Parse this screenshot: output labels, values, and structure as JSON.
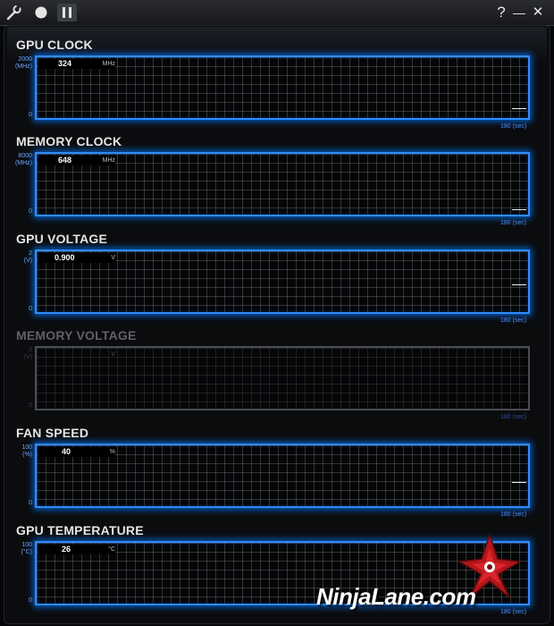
{
  "toolbar": {
    "help_label": "?",
    "minimize_label": "—",
    "close_label": "✕"
  },
  "panels": [
    {
      "title": "GPU CLOCK",
      "scale_max": "2000",
      "scale_unit": "(MHz)",
      "scale_min": "0",
      "value": "324",
      "unit": "MHz",
      "time_window": "180 (sec)",
      "current_level": 0.162,
      "enabled": true
    },
    {
      "title": "MEMORY CLOCK",
      "scale_max": "8000",
      "scale_unit": "(MHz)",
      "scale_min": "0",
      "value": "648",
      "unit": "MHz",
      "time_window": "180 (sec)",
      "current_level": 0.081,
      "enabled": true
    },
    {
      "title": "GPU VOLTAGE",
      "scale_max": "2",
      "scale_unit": "(V)",
      "scale_min": "0",
      "value": "0.900",
      "unit": "V",
      "time_window": "180 (sec)",
      "current_level": 0.45,
      "enabled": true
    },
    {
      "title": "MEMORY VOLTAGE",
      "scale_max": "2",
      "scale_unit": "(V)",
      "scale_min": "0",
      "value": "",
      "unit": "V",
      "time_window": "180 (sec)",
      "current_level": null,
      "enabled": false
    },
    {
      "title": "FAN SPEED",
      "scale_max": "100",
      "scale_unit": "(%)",
      "scale_min": "0",
      "value": "40",
      "unit": "%",
      "time_window": "180 (sec)",
      "current_level": 0.4,
      "enabled": true
    },
    {
      "title": "GPU TEMPERATURE",
      "scale_max": "100",
      "scale_unit": "(°C)",
      "scale_min": "0",
      "value": "26",
      "unit": "°C",
      "time_window": "180 (sec)",
      "current_level": 0.26,
      "enabled": true
    }
  ],
  "watermark": {
    "text": "NinjaLane.com"
  },
  "colors": {
    "accent": "#2f8cff",
    "grid": "#969696",
    "background": "#050608",
    "watermark_red": "#b3161b"
  }
}
